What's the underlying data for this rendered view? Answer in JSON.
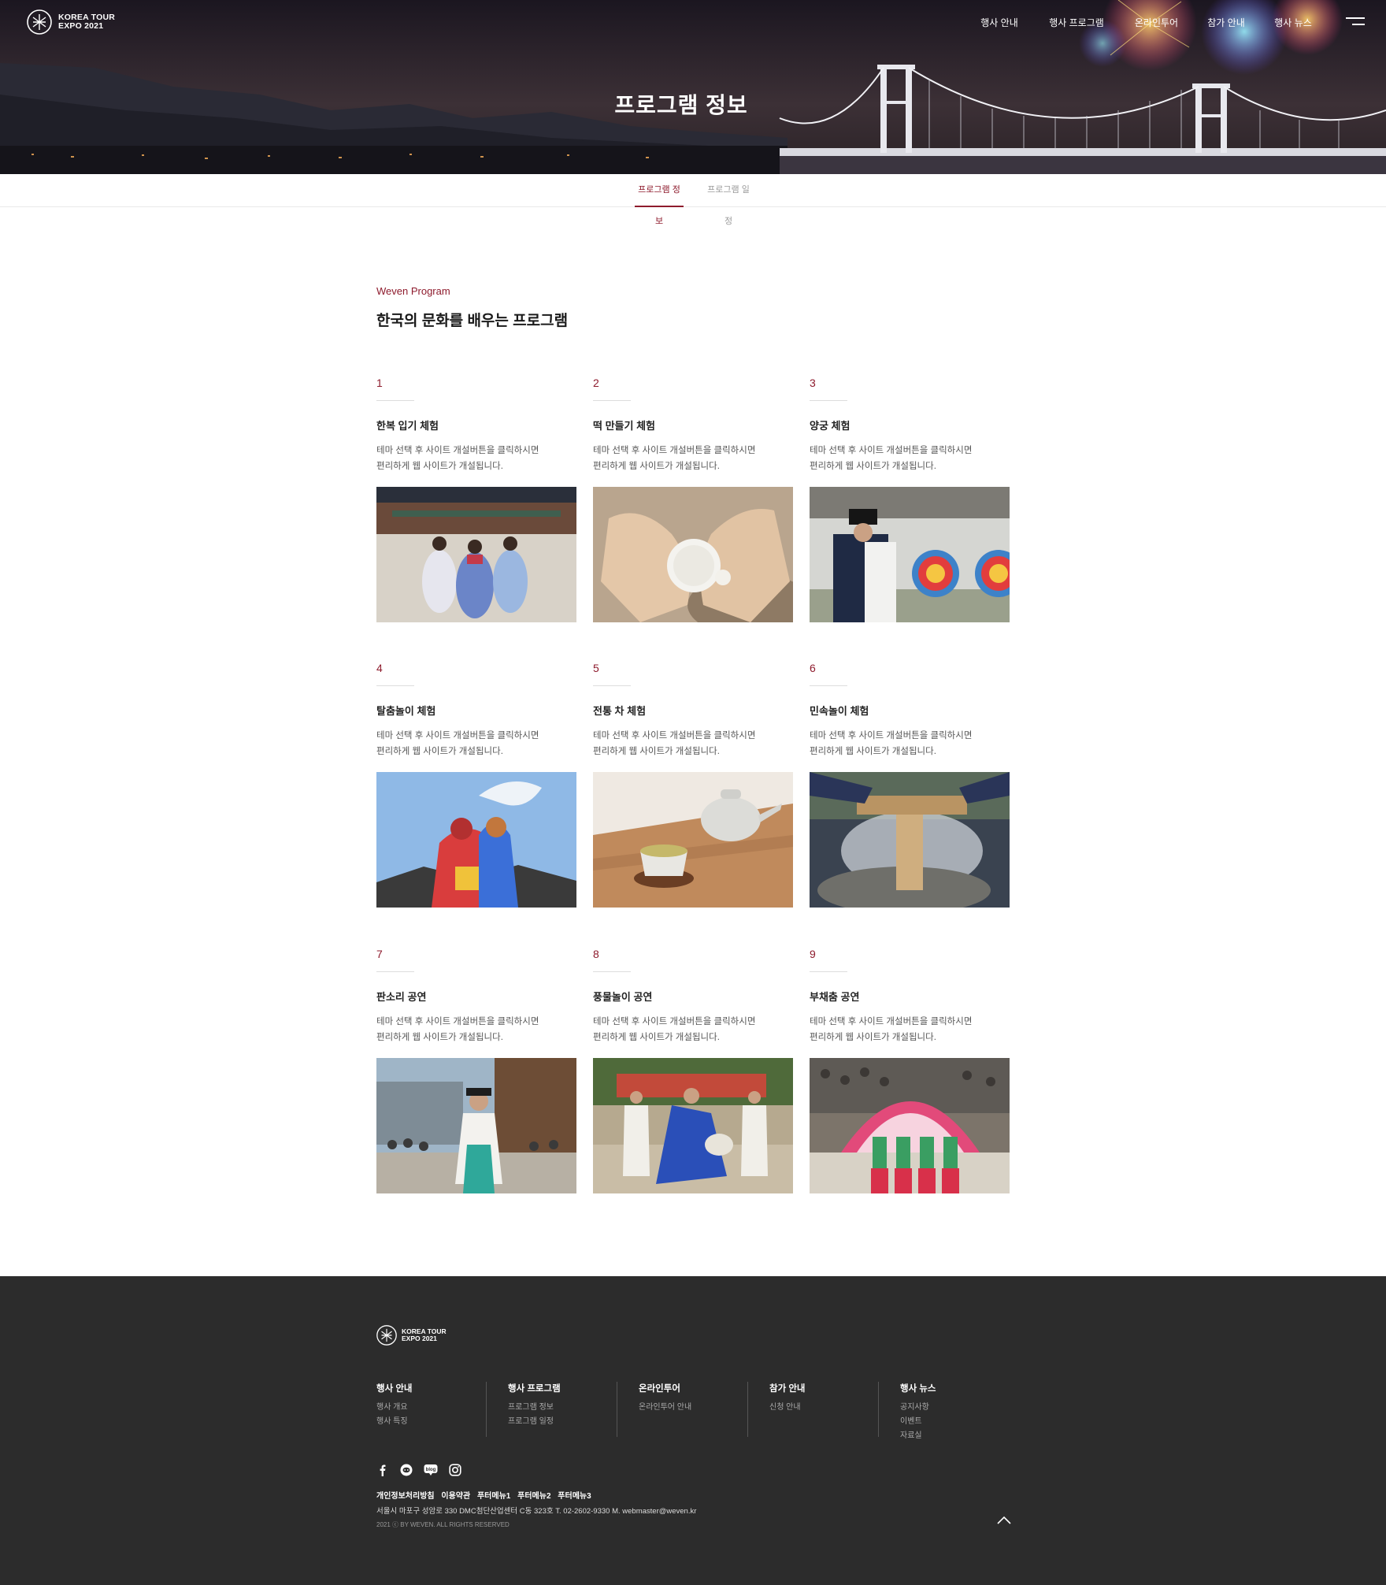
{
  "header": {
    "logo_line1": "KOREA TOUR",
    "logo_line2": "EXPO 2021",
    "nav": [
      "행사 안내",
      "행사 프로그램",
      "온라인투어",
      "참가 안내",
      "행사 뉴스"
    ],
    "hero_title": "프로그램 정보"
  },
  "tabs": [
    {
      "label": "프로그램 정보",
      "active": true
    },
    {
      "label": "프로그램 일정",
      "active": false
    }
  ],
  "section": {
    "eyebrow": "Weven Program",
    "title": "한국의 문화를 배우는 프로그램"
  },
  "programs": [
    {
      "num": "1",
      "title": "한복 입기 체험",
      "desc1": "테마 선택 후 사이트 개설버튼을 클릭하시면",
      "desc2": "편리하게 웹 사이트가 개설됩니다."
    },
    {
      "num": "2",
      "title": "떡 만들기 체험",
      "desc1": "테마 선택 후 사이트 개설버튼을 클릭하시면",
      "desc2": "편리하게 웹 사이트가 개설됩니다."
    },
    {
      "num": "3",
      "title": "양궁 체험",
      "desc1": "테마 선택 후 사이트 개설버튼을 클릭하시면",
      "desc2": "편리하게 웹 사이트가 개설됩니다."
    },
    {
      "num": "4",
      "title": "탈춤놀이 체험",
      "desc1": "테마 선택 후 사이트 개설버튼을 클릭하시면",
      "desc2": "편리하게 웹 사이트가 개설됩니다."
    },
    {
      "num": "5",
      "title": "전통 차 체험",
      "desc1": "테마 선택 후 사이트 개설버튼을 클릭하시면",
      "desc2": "편리하게 웹 사이트가 개설됩니다."
    },
    {
      "num": "6",
      "title": "민속놀이 체험",
      "desc1": "테마 선택 후 사이트 개설버튼을 클릭하시면",
      "desc2": "편리하게 웹 사이트가 개설됩니다."
    },
    {
      "num": "7",
      "title": "판소리 공연",
      "desc1": "테마 선택 후 사이트 개설버튼을 클릭하시면",
      "desc2": "편리하게 웹 사이트가 개설됩니다."
    },
    {
      "num": "8",
      "title": "풍물놀이 공연",
      "desc1": "테마 선택 후 사이트 개설버튼을 클릭하시면",
      "desc2": "편리하게 웹 사이트가 개설됩니다."
    },
    {
      "num": "9",
      "title": "부채춤 공연",
      "desc1": "테마 선택 후 사이트 개설버튼을 클릭하시면",
      "desc2": "편리하게 웹 사이트가 개설됩니다."
    }
  ],
  "footer": {
    "logo_line1": "KOREA TOUR",
    "logo_line2": "EXPO 2021",
    "columns": [
      {
        "head": "행사 안내",
        "links": [
          "행사 개요",
          "행사 특징"
        ]
      },
      {
        "head": "행사 프로그램",
        "links": [
          "프로그램 정보",
          "프로그램 일정"
        ]
      },
      {
        "head": "온라인투어",
        "links": [
          "온라인투어 안내"
        ]
      },
      {
        "head": "참가 안내",
        "links": [
          "신청 안내"
        ]
      },
      {
        "head": "행사 뉴스",
        "links": [
          "공지사항",
          "이벤트",
          "자료실"
        ]
      }
    ],
    "sns_icons": [
      "facebook-icon",
      "kakao-icon",
      "blog-icon",
      "instagram-icon"
    ],
    "sns_blog_label": "blog",
    "policy_links": [
      "개인정보처리방침",
      "이용약관",
      "푸터메뉴1",
      "푸터메뉴2",
      "푸터메뉴3"
    ],
    "address": "서울시 마포구 성암로 330 DMC첨단산업센터 C동 323호  T. 02-2602-9330 M. webmaster@weven.kr",
    "copyright": "2021 ⓒ BY WEVEN. ALL RIGHTS RESERVED"
  },
  "colors": {
    "accent": "#8e1b2d",
    "footer_bg": "#2c2c2c"
  }
}
